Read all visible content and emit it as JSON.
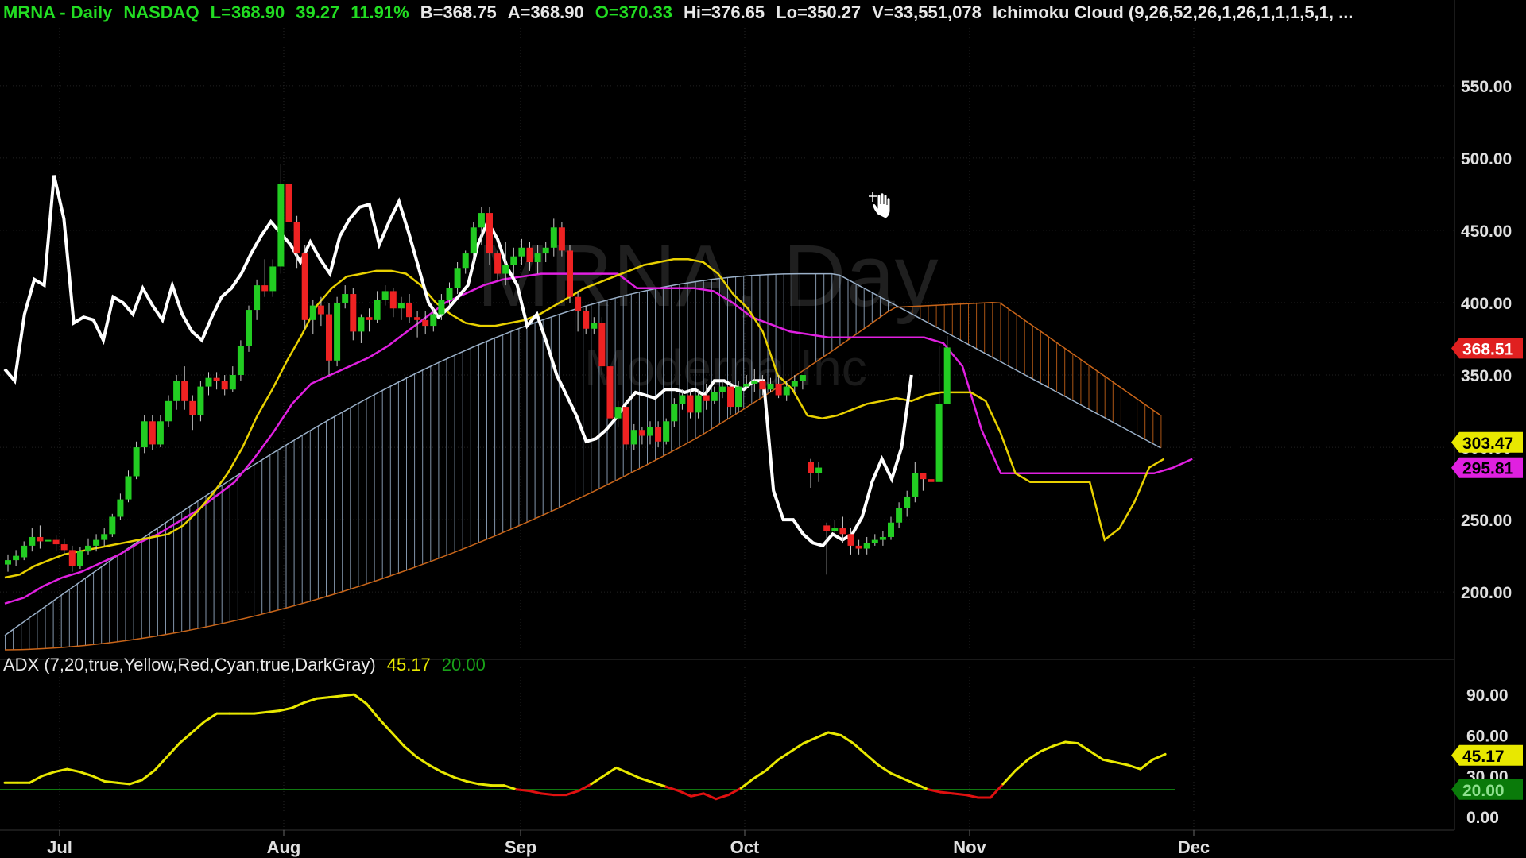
{
  "header": {
    "symbol": "MRNA - Daily",
    "exchange": "NASDAQ",
    "last": "L=368.90",
    "change": "39.27",
    "change_pct": "11.91%",
    "bid": "B=368.75",
    "ask": "A=368.90",
    "open": "O=370.33",
    "high": "Hi=376.65",
    "low": "Lo=350.27",
    "volume": "V=33,551,078",
    "study": "Ichimoku Cloud (9,26,52,26,1,26,1,1,1,5,1, ..."
  },
  "watermark": {
    "title": "MRNA, Day",
    "subtitle": "Moderna Inc"
  },
  "adx_header": {
    "label": "ADX (7,20,true,Yellow,Red,Cyan,true,DarkGray)",
    "value": "45.17",
    "threshold": "20.00"
  },
  "colors": {
    "up_candle": "#22cc22",
    "down_candle": "#ee2222",
    "tenkan": "#e8d000",
    "kijun": "#e020e0",
    "chikou": "#ffffff",
    "cloud_bull": "#9ab0c8",
    "cloud_bear": "#c86418",
    "adx": "#e8e800",
    "adx_low": "#e01010",
    "threshold": "#107810"
  },
  "chart_data": [
    {
      "type": "candlestick",
      "title": "MRNA - Daily",
      "x_labels": [
        "Jul",
        "Aug",
        "Sep",
        "Oct",
        "Nov",
        "Dec"
      ],
      "y_ticks": [
        "550.00",
        "500.00",
        "450.00",
        "400.00",
        "350.00",
        "300.00",
        "250.00",
        "200.00"
      ],
      "ylim": [
        160,
        590
      ],
      "price_tags": [
        {
          "value": 368.51,
          "label": "368.51",
          "color": "#e02020"
        },
        {
          "value": 303.47,
          "label": "303.47",
          "color": "#e8e800"
        },
        {
          "value": 295.81,
          "label": "295.81",
          "color": "#e020e0"
        }
      ],
      "candles": [
        [
          219,
          222,
          214,
          226
        ],
        [
          222,
          225,
          218,
          229
        ],
        [
          224,
          232,
          222,
          235
        ],
        [
          232,
          238,
          228,
          244
        ],
        [
          238,
          235,
          230,
          246
        ],
        [
          235,
          236,
          231,
          240
        ],
        [
          236,
          233,
          228,
          239
        ],
        [
          233,
          229,
          226,
          237
        ],
        [
          229,
          218,
          214,
          232
        ],
        [
          218,
          228,
          216,
          231
        ],
        [
          228,
          232,
          226,
          237
        ],
        [
          232,
          236,
          228,
          240
        ],
        [
          236,
          240,
          232,
          244
        ],
        [
          240,
          252,
          238,
          254
        ],
        [
          252,
          264,
          250,
          268
        ],
        [
          264,
          280,
          262,
          284
        ],
        [
          280,
          300,
          278,
          304
        ],
        [
          300,
          318,
          296,
          322
        ],
        [
          318,
          302,
          298,
          322
        ],
        [
          302,
          318,
          300,
          322
        ],
        [
          318,
          332,
          314,
          336
        ],
        [
          332,
          346,
          326,
          350
        ],
        [
          346,
          332,
          326,
          356
        ],
        [
          332,
          322,
          312,
          336
        ],
        [
          322,
          342,
          318,
          346
        ],
        [
          342,
          348,
          336,
          352
        ],
        [
          348,
          346,
          340,
          352
        ],
        [
          346,
          340,
          336,
          350
        ],
        [
          340,
          350,
          338,
          356
        ],
        [
          350,
          370,
          346,
          374
        ],
        [
          370,
          395,
          366,
          398
        ],
        [
          395,
          412,
          388,
          416
        ],
        [
          412,
          408,
          404,
          430
        ],
        [
          408,
          425,
          404,
          430
        ],
        [
          425,
          482,
          420,
          496
        ],
        [
          482,
          456,
          446,
          498
        ],
        [
          456,
          434,
          424,
          460
        ],
        [
          434,
          388,
          382,
          440
        ],
        [
          388,
          398,
          378,
          402
        ],
        [
          398,
          392,
          384,
          404
        ],
        [
          392,
          360,
          350,
          400
        ],
        [
          360,
          400,
          356,
          404
        ],
        [
          400,
          406,
          396,
          412
        ],
        [
          406,
          380,
          374,
          410
        ],
        [
          380,
          390,
          372,
          392
        ],
        [
          390,
          388,
          380,
          396
        ],
        [
          388,
          402,
          386,
          408
        ],
        [
          402,
          408,
          398,
          412
        ],
        [
          408,
          396,
          390,
          410
        ],
        [
          396,
          400,
          388,
          404
        ],
        [
          400,
          390,
          386,
          406
        ],
        [
          390,
          388,
          376,
          394
        ],
        [
          388,
          384,
          378,
          394
        ],
        [
          384,
          392,
          380,
          396
        ],
        [
          392,
          402,
          388,
          406
        ],
        [
          402,
          410,
          398,
          414
        ],
        [
          410,
          424,
          406,
          428
        ],
        [
          424,
          434,
          420,
          436
        ],
        [
          434,
          452,
          428,
          456
        ],
        [
          452,
          462,
          440,
          466
        ],
        [
          462,
          434,
          426,
          466
        ],
        [
          434,
          420,
          416,
          436
        ],
        [
          420,
          426,
          412,
          442
        ],
        [
          426,
          432,
          418,
          438
        ],
        [
          432,
          438,
          426,
          444
        ],
        [
          438,
          428,
          422,
          442
        ],
        [
          428,
          434,
          420,
          440
        ],
        [
          434,
          438,
          428,
          442
        ],
        [
          438,
          452,
          432,
          458
        ],
        [
          452,
          436,
          432,
          456
        ],
        [
          436,
          404,
          400,
          440
        ],
        [
          404,
          394,
          380,
          408
        ],
        [
          394,
          382,
          378,
          398
        ],
        [
          382,
          386,
          378,
          390
        ],
        [
          386,
          356,
          350,
          390
        ],
        [
          356,
          320,
          318,
          360
        ],
        [
          320,
          328,
          314,
          332
        ],
        [
          328,
          302,
          298,
          332
        ],
        [
          302,
          312,
          298,
          316
        ],
        [
          312,
          308,
          302,
          314
        ],
        [
          308,
          314,
          302,
          318
        ],
        [
          314,
          304,
          300,
          318
        ],
        [
          304,
          318,
          302,
          320
        ],
        [
          318,
          330,
          314,
          334
        ],
        [
          330,
          336,
          326,
          340
        ],
        [
          336,
          324,
          320,
          340
        ],
        [
          324,
          336,
          320,
          340
        ],
        [
          336,
          332,
          326,
          344
        ],
        [
          332,
          338,
          330,
          342
        ],
        [
          338,
          342,
          334,
          346
        ],
        [
          342,
          328,
          322,
          346
        ],
        [
          328,
          342,
          324,
          346
        ],
        [
          342,
          344,
          340,
          350
        ],
        [
          344,
          346,
          338,
          354
        ],
        [
          346,
          340,
          336,
          350
        ],
        [
          340,
          344,
          338,
          348
        ],
        [
          344,
          336,
          334,
          350
        ],
        [
          336,
          342,
          332,
          346
        ],
        [
          342,
          346,
          338,
          350
        ],
        [
          346,
          350,
          340,
          350
        ],
        [
          290,
          282,
          272,
          292
        ],
        [
          282,
          286,
          276,
          290
        ],
        [
          246,
          242,
          212,
          248
        ],
        [
          242,
          244,
          238,
          250
        ],
        [
          244,
          240,
          234,
          252
        ],
        [
          240,
          232,
          226,
          244
        ],
        [
          232,
          230,
          226,
          236
        ],
        [
          230,
          234,
          226,
          238
        ],
        [
          234,
          236,
          232,
          240
        ],
        [
          236,
          238,
          232,
          242
        ],
        [
          238,
          248,
          236,
          252
        ],
        [
          248,
          258,
          244,
          262
        ],
        [
          258,
          266,
          252,
          270
        ],
        [
          266,
          282,
          262,
          290
        ],
        [
          282,
          278,
          270,
          282
        ],
        [
          278,
          276,
          270,
          280
        ],
        [
          276,
          330,
          316,
          370
        ],
        [
          330,
          369,
          330,
          377
        ]
      ],
      "tenkan": [
        210,
        212,
        218,
        222,
        226,
        228,
        230,
        232,
        234,
        236,
        238,
        240,
        246,
        256,
        268,
        282,
        300,
        322,
        340,
        360,
        378,
        398,
        410,
        418,
        420,
        422,
        422,
        420,
        412,
        400,
        392,
        386,
        384,
        384,
        386,
        388,
        392,
        398,
        404,
        410,
        414,
        418,
        422,
        426,
        428,
        430,
        430,
        428,
        420,
        406,
        396,
        380,
        350,
        340,
        322,
        320,
        322,
        326,
        330,
        332,
        334,
        332,
        336,
        338,
        338,
        338,
        332,
        310,
        282,
        276,
        276,
        276,
        276,
        276,
        236,
        244,
        262,
        286,
        292
      ],
      "kijun": [
        192,
        196,
        204,
        210,
        214,
        220,
        226,
        234,
        240,
        248,
        256,
        266,
        276,
        292,
        310,
        330,
        344,
        350,
        356,
        362,
        370,
        380,
        390,
        400,
        406,
        412,
        416,
        418,
        420,
        420,
        420,
        420,
        420,
        410,
        410,
        410,
        410,
        408,
        400,
        390,
        385,
        380,
        378,
        376,
        376,
        376,
        376,
        376,
        376,
        372,
        356,
        312,
        282,
        282,
        282,
        282,
        282,
        282,
        282,
        282,
        282,
        286,
        292
      ],
      "chikou": [
        354,
        346,
        392,
        416,
        412,
        488,
        458,
        386,
        390,
        388,
        374,
        404,
        400,
        392,
        410,
        398,
        388,
        412,
        392,
        380,
        374,
        390,
        404,
        410,
        420,
        434,
        446,
        456,
        448,
        440,
        428,
        442,
        430,
        420,
        446,
        458,
        466,
        468,
        440,
        456,
        470,
        448,
        424,
        400,
        390,
        396,
        404,
        412,
        440,
        456,
        444,
        424,
        412,
        384,
        392,
        372,
        350,
        336,
        322,
        304,
        306,
        312,
        320,
        330,
        338,
        336,
        334,
        340,
        340,
        338,
        340,
        336,
        346,
        346,
        342,
        340,
        346,
        346,
        270,
        250,
        250,
        240,
        234,
        232,
        240,
        236,
        240,
        252,
        276,
        292,
        278,
        300,
        350
      ]
    },
    {
      "type": "line",
      "title": "ADX (7,20,true,Yellow,Red,Cyan,true,DarkGray)",
      "y_ticks": [
        "90.00",
        "60.00",
        "30.00",
        "0.00"
      ],
      "ylim": [
        -10,
        110
      ],
      "threshold": 20,
      "current": 45.17,
      "adx": [
        25,
        25,
        25,
        30,
        33,
        35,
        33,
        30,
        26,
        25,
        24,
        27,
        34,
        44,
        54,
        62,
        70,
        76,
        76,
        76,
        76,
        77,
        78,
        80,
        84,
        87,
        88,
        89,
        90,
        83,
        72,
        62,
        52,
        44,
        38,
        33,
        29,
        26,
        24,
        23,
        23,
        20,
        19,
        17,
        16,
        16,
        19,
        24,
        30,
        36,
        32,
        28,
        25,
        22,
        19,
        15,
        17,
        13,
        16,
        21,
        28,
        34,
        42,
        48,
        54,
        58,
        62,
        60,
        54,
        46,
        38,
        32,
        28,
        24,
        20,
        18,
        17,
        16,
        14,
        14,
        24,
        34,
        42,
        48,
        52,
        55,
        54,
        48,
        42,
        40,
        38,
        35,
        42,
        46
      ]
    }
  ]
}
